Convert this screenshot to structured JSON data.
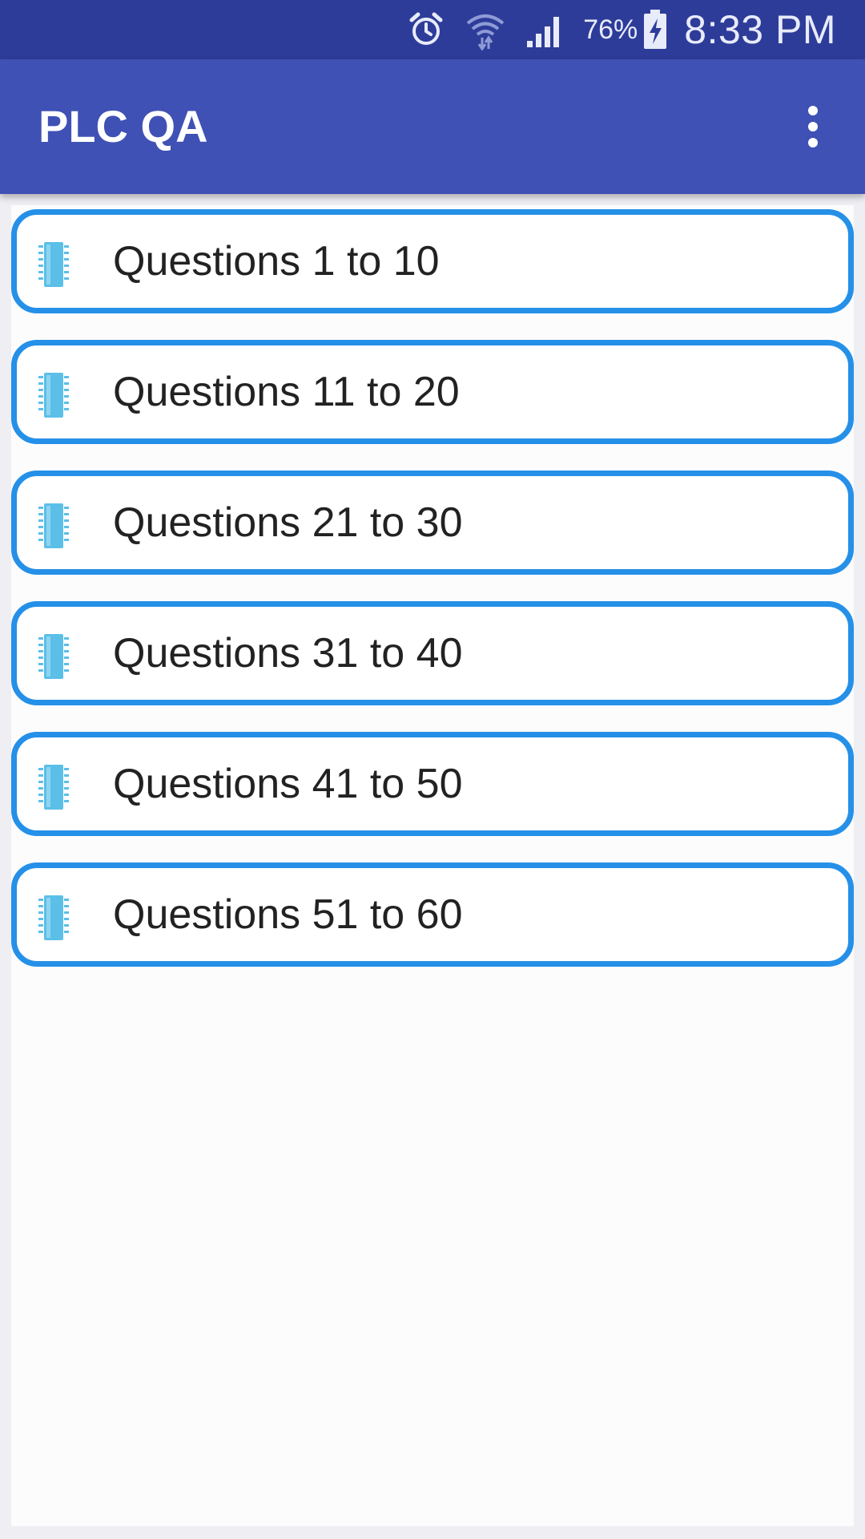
{
  "status_bar": {
    "battery": "76%",
    "time": "8:33 PM",
    "icons": [
      "alarm-icon",
      "wifi-icon",
      "signal-icon",
      "battery-charging-icon"
    ]
  },
  "app_bar": {
    "title": "PLC QA",
    "menu_icon": "more-vert-icon"
  },
  "list": {
    "item_icon": "chip-icon",
    "items": [
      {
        "label": "Questions 1 to 10"
      },
      {
        "label": "Questions 11 to 20"
      },
      {
        "label": "Questions 21 to 30"
      },
      {
        "label": "Questions 31 to 40"
      },
      {
        "label": "Questions 41 to 50"
      },
      {
        "label": "Questions 51 to 60"
      }
    ]
  },
  "colors": {
    "status_bar": "#2e3c99",
    "app_bar": "#3f51b5",
    "item_border": "#2590e8",
    "icon": "#5bbfe8"
  }
}
